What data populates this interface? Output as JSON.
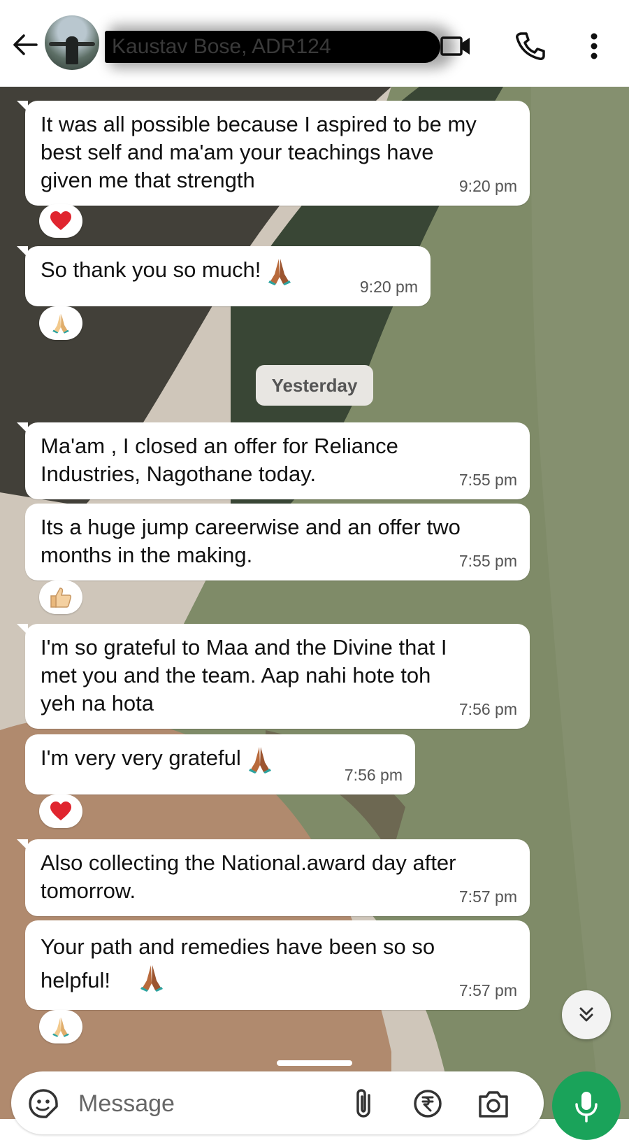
{
  "header": {
    "contact_name": "Kaustav Bose, ADR124",
    "icons": [
      "back-arrow-icon",
      "video-call-icon",
      "phone-icon",
      "more-options-icon"
    ]
  },
  "messages": [
    {
      "text": "It was all possible because I aspired to be my\nbest self and ma'am your teachings have\ngiven me that strength",
      "time": "9:20 pm",
      "reaction": "heart"
    },
    {
      "text": "So thank you so much!",
      "time": "9:20 pm",
      "emoji": "folded-hands",
      "reaction": "folded-hands"
    },
    {
      "text": "Ma'am , I closed an offer for Reliance\nIndustries, Nagothane today.",
      "time": "7:55 pm"
    },
    {
      "text": "Its a huge jump careerwise and an offer two\nmonths in the making.",
      "time": "7:55 pm",
      "reaction": "thumbs-up"
    },
    {
      "text": "I'm so grateful to Maa and the Divine that I\nmet you and the team. Aap nahi hote toh\nyeh na hota",
      "time": "7:56 pm"
    },
    {
      "text": "I'm very very grateful",
      "time": "7:56 pm",
      "emoji": "folded-hands",
      "reaction": "heart"
    },
    {
      "text": "Also collecting the National.award day after\ntomorrow.",
      "time": "7:57 pm"
    },
    {
      "text": "Your path and remedies have been so so\nhelpful!",
      "time": "7:57 pm",
      "emoji": "folded-hands",
      "reaction": "folded-hands"
    }
  ],
  "date_separator": "Yesterday",
  "composer": {
    "placeholder": "Message",
    "icons": [
      "emoji-sticker-icon",
      "attach-icon",
      "rupee-payment-icon",
      "camera-icon",
      "mic-icon"
    ]
  },
  "colors": {
    "accent_green": "#1aa35a",
    "bubble": "#ffffff",
    "wallpaper_olive": "#7d8a66",
    "wallpaper_dark": "#3f3f38",
    "wallpaper_tan": "#b38e72"
  }
}
